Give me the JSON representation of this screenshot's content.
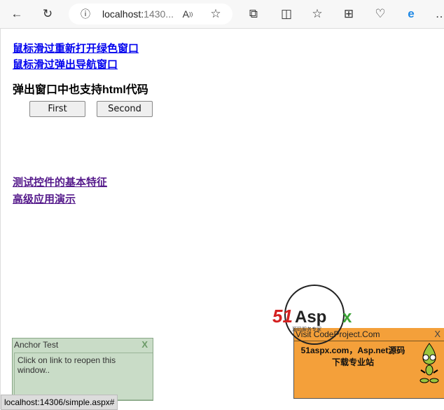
{
  "browser": {
    "url_host": "localhost:",
    "url_rest": "1430...",
    "icons": [
      "back-icon",
      "refresh-icon",
      "info-icon",
      "read-aloud-icon",
      "favorite-star-icon",
      "extensions-icon",
      "split-screen-icon",
      "favorites-icon",
      "collections-icon",
      "browser-essentials-icon",
      "ie-mode-icon",
      "more-icon"
    ]
  },
  "links": {
    "reopen_green": "鼠标滑过重新打开绿色窗口",
    "popup_nav": "鼠标滑过弹出导航窗口",
    "basic_features": "测试控件的基本特征",
    "advanced_demo": "高级应用演示"
  },
  "heading": "弹出窗口中也支持html代码",
  "buttons": {
    "first": "First",
    "second": "Second"
  },
  "anchor_window": {
    "title": "Anchor Test",
    "close": "X",
    "body": "Click on link to reopen this window.."
  },
  "logo": {
    "text": "51Aspx",
    "tagline": "源码服务专家"
  },
  "ad_window": {
    "title": "Visit CodeProject.Com",
    "close": "X",
    "message": "51aspx.com，Asp.net源码下载专业站"
  },
  "status_bar": "localhost:14306/simple.aspx#",
  "colors": {
    "link": "#0000ee",
    "visited": "#551a8b",
    "anchor_bg": "#c9dcc7",
    "ad_bg": "#f4a03a"
  }
}
